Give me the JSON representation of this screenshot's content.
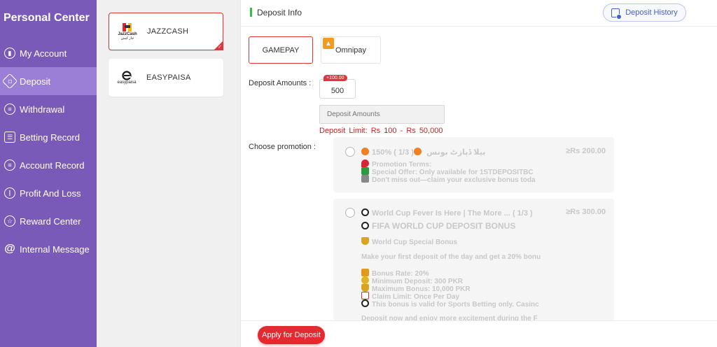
{
  "sidebar": {
    "title": "Personal Center",
    "items": [
      {
        "label": "My Account"
      },
      {
        "label": "Deposit"
      },
      {
        "label": "Withdrawal"
      },
      {
        "label": "Betting Record"
      },
      {
        "label": "Account Record"
      },
      {
        "label": "Profit And Loss"
      },
      {
        "label": "Reward Center"
      },
      {
        "label": "Internal Message"
      }
    ]
  },
  "channels": [
    {
      "label": "JAZZCASH",
      "logo_text_top": "JazzCash",
      "logo_text_bottom": "جاز کیش"
    },
    {
      "label": "EASYPAISA",
      "logo_text": "easypaisa"
    }
  ],
  "main": {
    "title": "Deposit Info",
    "history_label": "Deposit History",
    "methods": [
      {
        "label": "GAMEPAY"
      },
      {
        "label": "Omnipay"
      }
    ],
    "amounts_label": "Deposit Amounts :",
    "amount_option": {
      "value": "500",
      "bonus": "+100.00"
    },
    "amount_placeholder": "Deposit Amounts",
    "limit_text": "Deposit Limit:  Rs  100  - Rs  50,000",
    "promo_label": "Choose promotion :",
    "promotions": [
      {
        "title": "150% بیلا ڈپازٹ بونس",
        "count": "( 1/3 )",
        "amount": "≥Rs  200.00",
        "lines": [
          "Promotion Terms:",
          "Special Offer: Only available for 1STDEPOSITBC",
          "Don't miss out—claim your exclusive bonus toda"
        ]
      },
      {
        "title": "World Cup Fever Is Here | The More ...",
        "count": "( 1/3 )",
        "amount": "≥Rs  300.00",
        "heading": "FIFA WORLD CUP DEPOSIT BONUS",
        "subheading": "World Cup Special Bonus",
        "intro": "Make your first deposit of the day and get a 20% bonu",
        "details": [
          "Bonus Rate: 20%",
          "Minimum Deposit: 300 PKR",
          "Maximum Bonus: 10,000 PKR",
          "Claim Limit: Once Per Day",
          "This bonus is valid for Sports Betting only. Casinc"
        ],
        "outro": "Deposit now and enjoy more excitement during the F"
      }
    ],
    "apply_label": "Apply for Deposit"
  },
  "colors": {
    "sidebar": "#7a5ab8",
    "sidebar_active": "#9b7fd6",
    "accent_red": "#e52a2f",
    "link_blue": "#3e63c8",
    "green_bar": "#2ec43a"
  }
}
